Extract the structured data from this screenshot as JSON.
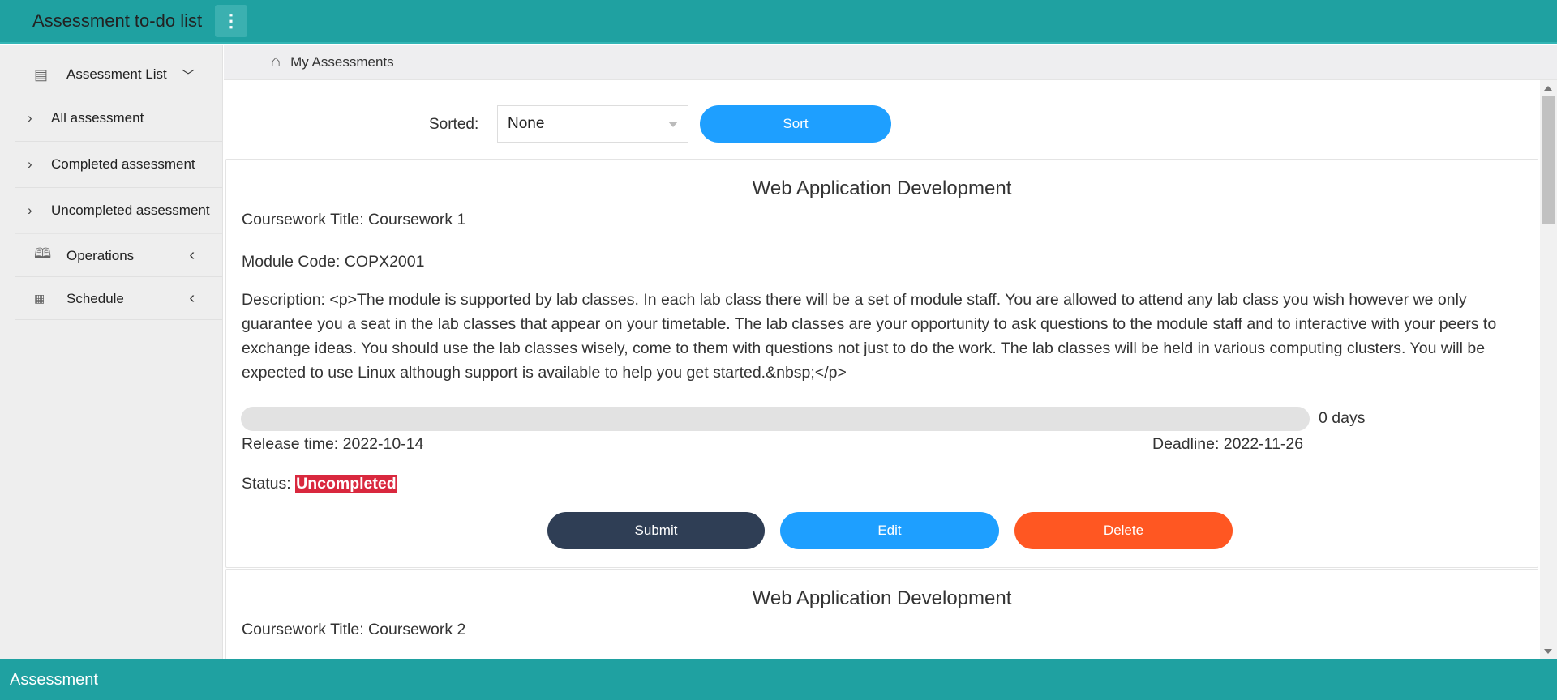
{
  "header": {
    "title": "Assessment to-do list",
    "menu_icon": "more-vertical-icon"
  },
  "sidebar": {
    "group": {
      "label": "Assessment List",
      "icon": "list-icon"
    },
    "items": [
      {
        "label": "All assessment"
      },
      {
        "label": "Completed assessment"
      },
      {
        "label": "Uncompleted assessment"
      }
    ],
    "sections": [
      {
        "label": "Operations",
        "icon": "book-icon"
      },
      {
        "label": "Schedule",
        "icon": "calendar-grid-icon"
      }
    ]
  },
  "breadcrumb": {
    "label": "My Assessments",
    "icon": "home-icon"
  },
  "sort": {
    "label": "Sorted:",
    "selected": "None",
    "button": "Sort"
  },
  "cards": [
    {
      "module": "Web Application Development",
      "title": "Coursework Title: Coursework 1",
      "code": "Module Code: COPX2001",
      "description": "Description: <p>The module is supported by lab classes. In each lab class there will be a set of module staff. You are allowed to attend any lab class you wish however we only guarantee you a seat in the lab classes that appear on your timetable. The lab classes are your opportunity to ask questions to the module staff and to interactive with your peers to exchange ideas. You should use the lab classes wisely, come to them with questions not just to do the work. The lab classes will be held in various computing clusters. You will be expected to use Linux although support is available to help you get started.&nbsp;</p>",
      "progress_percent": 0,
      "days": "0 days",
      "release": "Release time: 2022-10-14",
      "deadline": "Deadline: 2022-11-26",
      "status_label": "Status:",
      "status": "Uncompleted",
      "buttons": {
        "submit": "Submit",
        "edit": "Edit",
        "delete": "Delete"
      }
    },
    {
      "module": "Web Application Development",
      "title": "Coursework Title: Coursework 2"
    }
  ],
  "colors": {
    "header": "#1fa1a1",
    "primary": "#1e9fff",
    "submit": "#2f3e55",
    "delete": "#ff5722",
    "status_uncompleted": "#d9283e"
  },
  "footer": {
    "label": "Assessment"
  }
}
